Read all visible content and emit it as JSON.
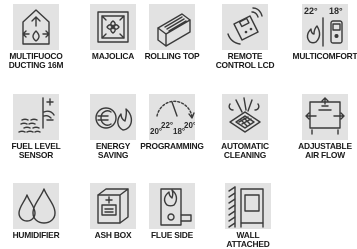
{
  "features": [
    {
      "icon": "fireplace-ducting-icon",
      "lines": [
        "MULTIFUOCO",
        "DUCTING 16M"
      ]
    },
    {
      "icon": "majolica-tile-icon",
      "lines": [
        "MAJOLICA"
      ]
    },
    {
      "icon": "rolling-top-icon",
      "lines": [
        "ROLLING TOP"
      ]
    },
    {
      "icon": "remote-control-icon",
      "lines": [
        "REMOTE",
        "CONTROL LCD"
      ]
    },
    {
      "icon": "multicomfort-icon",
      "lines": [
        "MULTICOMFORT"
      ],
      "temp_left": "22°",
      "temp_right": "18°"
    },
    {
      "icon": "fuel-level-sensor-icon",
      "lines": [
        "FUEL LEVEL",
        "SENSOR"
      ]
    },
    {
      "icon": "energy-saving-icon",
      "lines": [
        "ENERGY",
        "SAVING"
      ]
    },
    {
      "icon": "programming-icon",
      "lines": [
        "PROGRAMMING"
      ],
      "temps": [
        "20°",
        "22°",
        "18°",
        "20°"
      ]
    },
    {
      "icon": "automatic-cleaning-icon",
      "lines": [
        "AUTOMATIC",
        "CLEANING"
      ]
    },
    {
      "icon": "adjustable-airflow-icon",
      "lines": [
        "ADJUSTABLE",
        "AIR FLOW"
      ]
    },
    {
      "icon": "humidifier-icon",
      "lines": [
        "HUMIDIFIER"
      ]
    },
    {
      "icon": "ash-box-icon",
      "lines": [
        "ASH BOX"
      ]
    },
    {
      "icon": "flue-side-icon",
      "lines": [
        "FLUE SIDE"
      ]
    },
    {
      "icon": "wall-attached-icon",
      "lines": [
        "WALL",
        "ATTACHED"
      ]
    }
  ]
}
